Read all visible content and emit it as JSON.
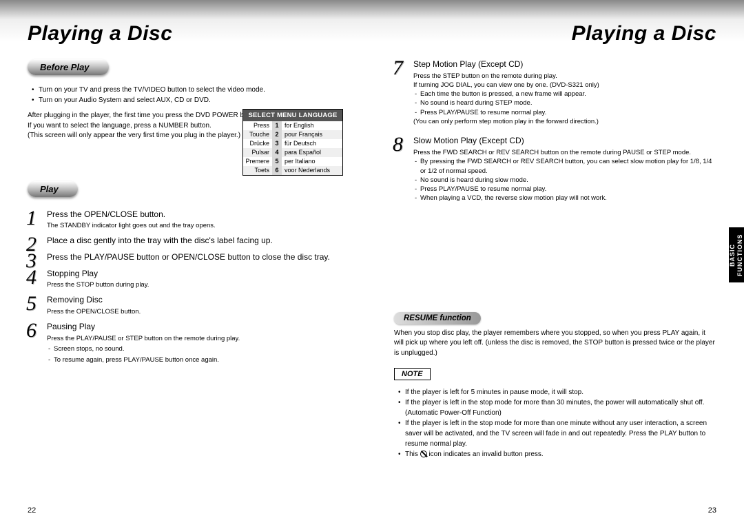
{
  "titleLeft": "Playing a Disc",
  "titleRight": "Playing a Disc",
  "pill_before": "Before Play",
  "pill_play": "Play",
  "before_bullets": [
    "Turn on your TV and press the TV/VIDEO button to select the video mode.",
    "Turn on your Audio System and select AUX, CD or DVD."
  ],
  "before_para1": "After plugging in the player, the first time you press the DVD POWER button, this screen comes up :",
  "before_para2": "If you want to select the language, press a NUMBER button.",
  "before_para3": "(This screen will only appear the very first time you plug in the player.)",
  "lang": {
    "head": "SELECT MENU LANGUAGE",
    "rows": [
      {
        "c1": "Press",
        "c2": "1",
        "c3": "for English"
      },
      {
        "c1": "Touche",
        "c2": "2",
        "c3": "pour Français"
      },
      {
        "c1": "Drücke",
        "c2": "3",
        "c3": "für Deutsch"
      },
      {
        "c1": "Pulsar",
        "c2": "4",
        "c3": "para Español"
      },
      {
        "c1": "Premere",
        "c2": "5",
        "c3": "per Italiano"
      },
      {
        "c1": "Toets",
        "c2": "6",
        "c3": "voor Nederlands"
      }
    ]
  },
  "steps_left": [
    {
      "n": "1",
      "title": "Press the OPEN/CLOSE button.",
      "body": [
        "The STANDBY indicator light goes out and the tray opens."
      ]
    },
    {
      "n": "2",
      "title": "Place a disc gently into the tray with the disc's label facing up.",
      "body": []
    },
    {
      "n": "3",
      "title": "Press the PLAY/PAUSE button or OPEN/CLOSE button to close the disc tray.",
      "body": []
    },
    {
      "n": "4",
      "title": "Stopping Play",
      "body": [
        "Press the STOP button during play."
      ]
    },
    {
      "n": "5",
      "title": "Removing Disc",
      "body": [
        "Press the OPEN/CLOSE button."
      ]
    },
    {
      "n": "6",
      "title": "Pausing Play",
      "body": [
        "Press the PLAY/PAUSE or STEP button on the remote during play.",
        "- Screen stops, no sound.",
        "- To resume again, press PLAY/PAUSE button once again."
      ]
    }
  ],
  "step7": {
    "n": "7",
    "title": "Step Motion Play (Except CD)",
    "body": [
      "Press the STEP button on the remote during play.",
      "If turning JOG DIAL, you can view one by one.  (DVD-S321 only)",
      "- Each time the button is pressed, a new frame will appear.",
      "- No sound is heard during STEP mode.",
      "- Press PLAY/PAUSE to resume normal play.",
      "(You can only perform step motion play in the forward direction.)"
    ]
  },
  "step8": {
    "n": "8",
    "title": "Slow Motion Play (Except CD)",
    "body": [
      "Press the FWD SEARCH or REV SEARCH button on the remote during PAUSE or STEP mode.",
      "- By pressing the FWD SEARCH or REV SEARCH button, you can select slow motion play for 1/8, 1/4 or 1/2 of normal speed.",
      "- No sound is heard during slow mode.",
      "- Press PLAY/PAUSE to resume normal play.",
      "- When playing a VCD, the reverse slow motion play will not work."
    ]
  },
  "resume_head": "RESUME function",
  "resume_body": "When you stop disc play, the player remembers where you stopped, so when you press PLAY again, it will pick up where you left off. (unless the disc is removed, the STOP button is pressed twice or the player is unplugged.)",
  "note_head": "NOTE",
  "notes": [
    "If the player is left for 5 minutes in pause mode, it will stop.",
    "If the player is left in the stop mode for more than 30 minutes, the power will automatically shut off. (Automatic Power-Off Function)",
    "If the player is left in the stop mode for more than one minute without any user interaction, a screen saver will be activated, and the TV screen will fade in and out repeatedly. Press the PLAY button to resume normal play."
  ],
  "note_icon_line_pre": "This ",
  "note_icon_line_post": " icon indicates an invalid button press.",
  "sidetab": "BASIC FUNCTIONS",
  "pnum_left": "22",
  "pnum_right": "23"
}
